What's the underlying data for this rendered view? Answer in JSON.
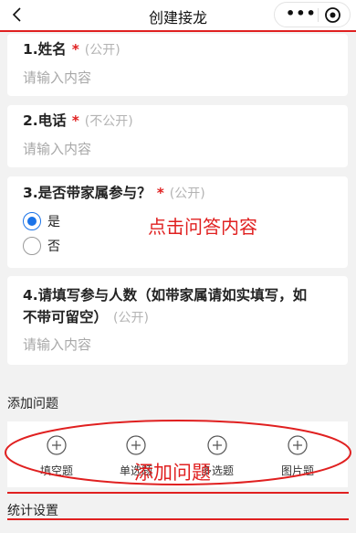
{
  "navbar": {
    "title": "创建接龙",
    "more_glyph": "•••"
  },
  "questions": [
    {
      "title": "1.姓名",
      "required_mark": "*",
      "visibility": "(公开)",
      "placeholder": "请输入内容"
    },
    {
      "title": "2.电话",
      "required_mark": "*",
      "visibility": "(不公开)",
      "placeholder": "请输入内容"
    },
    {
      "title": "3.是否带家属参与？",
      "required_mark": "*",
      "visibility": "(公开)",
      "options": [
        "是",
        "否"
      ],
      "selected": "是"
    },
    {
      "title_line1": "4.请填写参与人数（如带家属请如实填写，如",
      "title_line2": "不带可留空）",
      "visibility": "(公开)",
      "placeholder": "请输入内容"
    }
  ],
  "annotations": {
    "click_hint": "点击问答内容",
    "add_hint": "添加问题"
  },
  "add_section": {
    "label": "添加问题",
    "items": [
      {
        "label": "填空题",
        "icon": "plus-circle-icon"
      },
      {
        "label": "单选题",
        "icon": "plus-circle-icon"
      },
      {
        "label": "多选题",
        "icon": "plus-circle-icon"
      },
      {
        "label": "图片题",
        "icon": "plus-circle-icon"
      }
    ]
  },
  "stats_section": {
    "label": "统计设置"
  },
  "colors": {
    "annotation_red": "#e02020",
    "radio_blue": "#1a73e8",
    "background": "#f2f2f2"
  }
}
